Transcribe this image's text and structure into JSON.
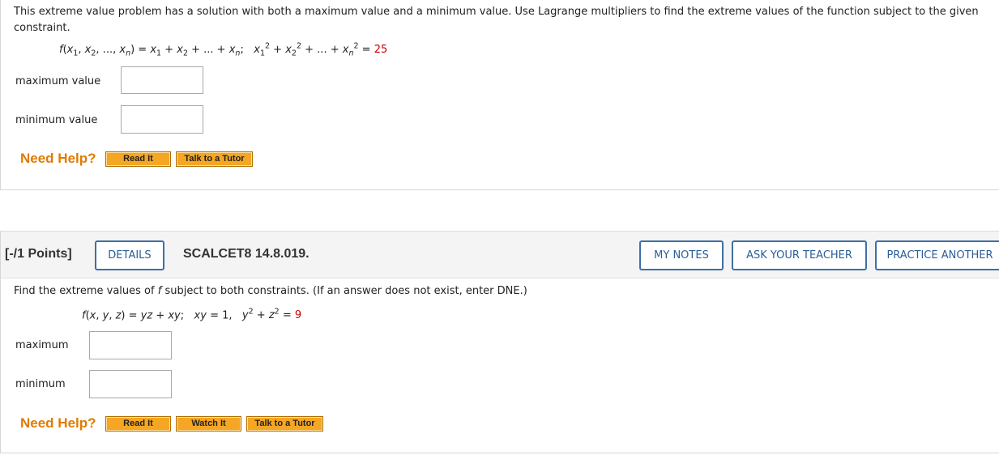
{
  "q1": {
    "prompt": "This extreme value problem has a solution with both a maximum value and a minimum value. Use Lagrange multipliers to find the extreme values of the function subject to the given constraint.",
    "function_lhs": "f(x1, x2, ..., xn)",
    "function_rhs": "x1 + x2 + ... + xn",
    "constraint_lhs": "x1^2 + x2^2 + ... + xn^2",
    "constraint_value": "25",
    "max_label": "maximum value",
    "min_label": "minimum value",
    "max_answer": "",
    "min_answer": "",
    "need_help": "Need Help?",
    "read_it": "Read It",
    "talk_to_tutor": "Talk to a Tutor"
  },
  "q2": {
    "points": "[-/1 Points]",
    "details": "DETAILS",
    "code": "SCALCET8 14.8.019.",
    "my_notes": "MY NOTES",
    "ask_teacher": "ASK YOUR TEACHER",
    "practice_another": "PRACTICE ANOTHER",
    "prompt_before_f": "Find the extreme values of ",
    "prompt_f": "f",
    "prompt_after_f": " subject to both constraints. (If an answer does not exist, enter DNE.)",
    "function_lhs": "f(x, y, z)",
    "function_rhs": "yz + xy",
    "constraint1": "xy = 1",
    "constraint2_lhs": "y^2 + z^2",
    "constraint2_value": "9",
    "max_label": "maximum",
    "min_label": "minimum",
    "max_answer": "",
    "min_answer": "",
    "need_help": "Need Help?",
    "read_it": "Read It",
    "watch_it": "Watch It",
    "talk_to_tutor": "Talk to a Tutor"
  },
  "colors": {
    "accent_blue": "#2b5e99",
    "help_orange": "#e07b00",
    "button_orange": "#f5a623",
    "constant_red": "#cc0000"
  }
}
